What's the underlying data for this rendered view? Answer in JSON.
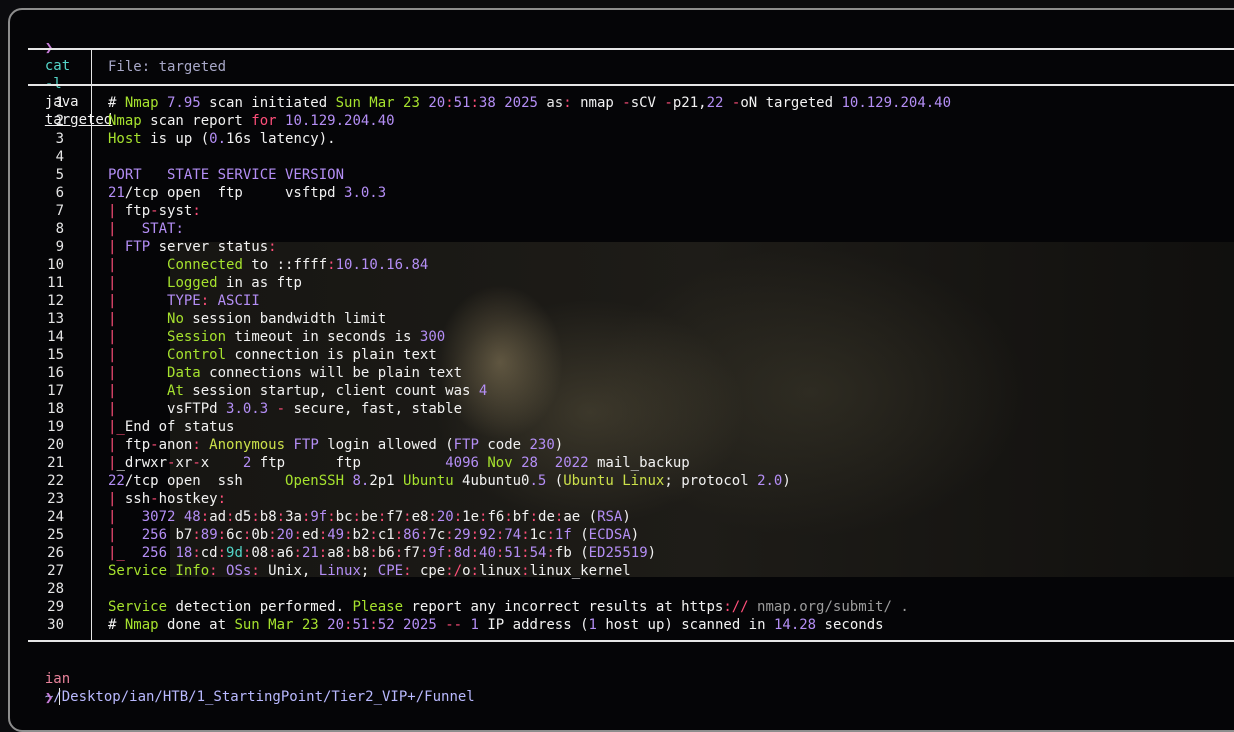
{
  "command": {
    "chevron": "❯",
    "cmd": "cat",
    "flag": "-l",
    "lang": "java",
    "file": "targeted"
  },
  "file_header": {
    "label": "File:",
    "name": "targeted"
  },
  "lines": [
    [
      [
        "# ",
        "w"
      ],
      [
        "Nmap",
        "g"
      ],
      [
        " 7.95",
        "p"
      ],
      [
        " scan initiated ",
        "w"
      ],
      [
        "Sun Mar 23",
        "g"
      ],
      [
        " 20",
        "p"
      ],
      [
        ":",
        "r"
      ],
      [
        "51",
        "p"
      ],
      [
        ":",
        "r"
      ],
      [
        "38",
        "p"
      ],
      [
        " 2025",
        "p"
      ],
      [
        " as",
        ""
      ],
      [
        ":",
        "r"
      ],
      [
        " nmap ",
        "w"
      ],
      [
        "-",
        "r"
      ],
      [
        "sCV ",
        "w"
      ],
      [
        "-",
        "r"
      ],
      [
        "p21",
        "w"
      ],
      [
        ",",
        "w"
      ],
      [
        "22",
        "p"
      ],
      [
        " ",
        "w"
      ],
      [
        "-",
        "r"
      ],
      [
        "oN targeted ",
        "w"
      ],
      [
        "10.129.204.40",
        "p"
      ]
    ],
    [
      [
        "Nmap",
        "g"
      ],
      [
        " scan report ",
        "w"
      ],
      [
        "for",
        "r"
      ],
      [
        " 10.129.204.40",
        "p"
      ]
    ],
    [
      [
        "Host",
        "g"
      ],
      [
        " is up (",
        "w"
      ],
      [
        "0.",
        "p"
      ],
      [
        "16s latency).",
        "w"
      ]
    ],
    [
      [
        "",
        ""
      ]
    ],
    [
      [
        "PORT   STATE SERVICE VERSION",
        "p"
      ]
    ],
    [
      [
        "21",
        "p"
      ],
      [
        "/tcp open  ftp     vsftpd ",
        "w"
      ],
      [
        "3.0.3",
        "p"
      ]
    ],
    [
      [
        "|",
        "r"
      ],
      [
        " ftp",
        "w"
      ],
      [
        "-",
        "r"
      ],
      [
        "syst",
        "w"
      ],
      [
        ":",
        "r"
      ]
    ],
    [
      [
        "|",
        "r"
      ],
      [
        "   STAT:",
        "p"
      ]
    ],
    [
      [
        "|",
        "r"
      ],
      [
        " FTP",
        "p"
      ],
      [
        " server status",
        "w"
      ],
      [
        ":",
        "r"
      ]
    ],
    [
      [
        "|",
        "r"
      ],
      [
        "      ",
        "w"
      ],
      [
        "Connected",
        "g"
      ],
      [
        " to ",
        "w"
      ],
      [
        "::",
        "w"
      ],
      [
        "ffff",
        "w"
      ],
      [
        ":",
        "r"
      ],
      [
        "10.10.16.84",
        "p"
      ]
    ],
    [
      [
        "|",
        "r"
      ],
      [
        "      ",
        "w"
      ],
      [
        "Logged",
        "g"
      ],
      [
        " in as ftp",
        "w"
      ]
    ],
    [
      [
        "|",
        "r"
      ],
      [
        "      ",
        "w"
      ],
      [
        "TYPE",
        "p"
      ],
      [
        ":",
        "r"
      ],
      [
        " ASCII",
        "p"
      ]
    ],
    [
      [
        "|",
        "r"
      ],
      [
        "      ",
        "w"
      ],
      [
        "No",
        "g"
      ],
      [
        " session bandwidth limit",
        "w"
      ]
    ],
    [
      [
        "|",
        "r"
      ],
      [
        "      ",
        "w"
      ],
      [
        "Session",
        "g"
      ],
      [
        " timeout in seconds is ",
        "w"
      ],
      [
        "300",
        "p"
      ]
    ],
    [
      [
        "|",
        "r"
      ],
      [
        "      ",
        "w"
      ],
      [
        "Control",
        "g"
      ],
      [
        " connection is plain text",
        "w"
      ]
    ],
    [
      [
        "|",
        "r"
      ],
      [
        "      ",
        "w"
      ],
      [
        "Data",
        "g"
      ],
      [
        " connections will be plain text",
        "w"
      ]
    ],
    [
      [
        "|",
        "r"
      ],
      [
        "      ",
        "w"
      ],
      [
        "At",
        "g"
      ],
      [
        " session startup, client count was ",
        "w"
      ],
      [
        "4",
        "p"
      ]
    ],
    [
      [
        "|",
        "r"
      ],
      [
        "      vsFTPd ",
        "w"
      ],
      [
        "3.0.3",
        "p"
      ],
      [
        " - ",
        "r"
      ],
      [
        "secure, fast, stable",
        "w"
      ]
    ],
    [
      [
        "|_",
        "r"
      ],
      [
        "End of status",
        "w"
      ]
    ],
    [
      [
        "|",
        "r"
      ],
      [
        " ftp",
        "w"
      ],
      [
        "-",
        "r"
      ],
      [
        "anon",
        "w"
      ],
      [
        ":",
        "r"
      ],
      [
        " Anonymous",
        "y"
      ],
      [
        " FTP",
        "p"
      ],
      [
        " login allowed (",
        "w"
      ],
      [
        "FTP",
        "p"
      ],
      [
        " code ",
        "w"
      ],
      [
        "230",
        "p"
      ],
      [
        ")",
        "w"
      ]
    ],
    [
      [
        "|",
        "r"
      ],
      [
        "_drwxr",
        "w"
      ],
      [
        "-",
        "r"
      ],
      [
        "xr",
        "w"
      ],
      [
        "-",
        "r"
      ],
      [
        "x    ",
        "w"
      ],
      [
        "2",
        "p"
      ],
      [
        " ftp      ftp          ",
        "w"
      ],
      [
        "4096",
        "p"
      ],
      [
        " Nov ",
        "g"
      ],
      [
        "28",
        "p"
      ],
      [
        "  2022",
        "p"
      ],
      [
        " mail_backup",
        "w"
      ]
    ],
    [
      [
        "22",
        "p"
      ],
      [
        "/tcp open  ssh     ",
        "w"
      ],
      [
        "OpenSSH",
        "g"
      ],
      [
        " 8.",
        "p"
      ],
      [
        "2p1 ",
        "w"
      ],
      [
        "Ubuntu",
        "g"
      ],
      [
        " 4ubuntu0",
        "w"
      ],
      [
        ".5",
        "p"
      ],
      [
        " (",
        "w"
      ],
      [
        "Ubuntu Linux",
        "y"
      ],
      [
        "; protocol ",
        "w"
      ],
      [
        "2.0",
        "p"
      ],
      [
        ")",
        "w"
      ]
    ],
    [
      [
        "|",
        "r"
      ],
      [
        " ssh",
        "w"
      ],
      [
        "-",
        "r"
      ],
      [
        "hostkey",
        "w"
      ],
      [
        ":",
        "r"
      ]
    ],
    [
      [
        "|",
        "r"
      ],
      [
        "   ",
        "w"
      ],
      [
        "3072",
        "p"
      ],
      [
        " 48",
        "p"
      ],
      [
        ":",
        "r"
      ],
      [
        "ad",
        "w"
      ],
      [
        ":",
        "r"
      ],
      [
        "d5",
        "w"
      ],
      [
        ":",
        "r"
      ],
      [
        "b8",
        "w"
      ],
      [
        ":",
        "r"
      ],
      [
        "3a",
        "w"
      ],
      [
        ":",
        "r"
      ],
      [
        "9f",
        "p"
      ],
      [
        ":",
        "r"
      ],
      [
        "bc",
        "w"
      ],
      [
        ":",
        "r"
      ],
      [
        "be",
        "w"
      ],
      [
        ":",
        "r"
      ],
      [
        "f7",
        "w"
      ],
      [
        ":",
        "r"
      ],
      [
        "e8",
        "w"
      ],
      [
        ":",
        "r"
      ],
      [
        "20",
        "p"
      ],
      [
        ":",
        "r"
      ],
      [
        "1e",
        "w"
      ],
      [
        ":",
        "r"
      ],
      [
        "f6",
        "w"
      ],
      [
        ":",
        "r"
      ],
      [
        "bf",
        "w"
      ],
      [
        ":",
        "r"
      ],
      [
        "de",
        "w"
      ],
      [
        ":",
        "r"
      ],
      [
        "ae",
        "w"
      ],
      [
        " (",
        "w"
      ],
      [
        "RSA",
        "p"
      ],
      [
        ")",
        "w"
      ]
    ],
    [
      [
        "|",
        "r"
      ],
      [
        "   ",
        "w"
      ],
      [
        "256",
        "p"
      ],
      [
        " b7",
        "w"
      ],
      [
        ":",
        "r"
      ],
      [
        "89",
        "p"
      ],
      [
        ":",
        "r"
      ],
      [
        "6c",
        "w"
      ],
      [
        ":",
        "r"
      ],
      [
        "0b",
        "w"
      ],
      [
        ":",
        "r"
      ],
      [
        "20",
        "p"
      ],
      [
        ":",
        "r"
      ],
      [
        "ed",
        "w"
      ],
      [
        ":",
        "r"
      ],
      [
        "49",
        "p"
      ],
      [
        ":",
        "r"
      ],
      [
        "b2",
        "w"
      ],
      [
        ":",
        "r"
      ],
      [
        "c1",
        "w"
      ],
      [
        ":",
        "r"
      ],
      [
        "86",
        "p"
      ],
      [
        ":",
        "r"
      ],
      [
        "7c",
        "w"
      ],
      [
        ":",
        "r"
      ],
      [
        "29",
        "p"
      ],
      [
        ":",
        "r"
      ],
      [
        "92",
        "p"
      ],
      [
        ":",
        "r"
      ],
      [
        "74",
        "p"
      ],
      [
        ":",
        "r"
      ],
      [
        "1c",
        "w"
      ],
      [
        ":",
        "r"
      ],
      [
        "1f",
        "p"
      ],
      [
        " (",
        "w"
      ],
      [
        "ECDSA",
        "p"
      ],
      [
        ")",
        "w"
      ]
    ],
    [
      [
        "|_",
        "r"
      ],
      [
        "  ",
        "w"
      ],
      [
        "256",
        "p"
      ],
      [
        " 18",
        "p"
      ],
      [
        ":",
        "r"
      ],
      [
        "cd",
        "w"
      ],
      [
        ":",
        "r"
      ],
      [
        "9d",
        "c"
      ],
      [
        ":",
        "r"
      ],
      [
        "08",
        "w"
      ],
      [
        ":",
        "r"
      ],
      [
        "a6",
        "w"
      ],
      [
        ":",
        "r"
      ],
      [
        "21",
        "p"
      ],
      [
        ":",
        "r"
      ],
      [
        "a8",
        "w"
      ],
      [
        ":",
        "r"
      ],
      [
        "b8",
        "w"
      ],
      [
        ":",
        "r"
      ],
      [
        "b6",
        "w"
      ],
      [
        ":",
        "r"
      ],
      [
        "f7",
        "w"
      ],
      [
        ":",
        "r"
      ],
      [
        "9f",
        "p"
      ],
      [
        ":",
        "r"
      ],
      [
        "8d",
        "p"
      ],
      [
        ":",
        "r"
      ],
      [
        "40",
        "p"
      ],
      [
        ":",
        "r"
      ],
      [
        "51",
        "p"
      ],
      [
        ":",
        "r"
      ],
      [
        "54",
        "p"
      ],
      [
        ":",
        "r"
      ],
      [
        "fb",
        "w"
      ],
      [
        " (",
        "w"
      ],
      [
        "ED25519",
        "p"
      ],
      [
        ")",
        "w"
      ]
    ],
    [
      [
        "Service Info",
        "g"
      ],
      [
        ":",
        "r"
      ],
      [
        " OSs",
        "p"
      ],
      [
        ":",
        "r"
      ],
      [
        " Unix",
        "w"
      ],
      [
        ", ",
        "w"
      ],
      [
        "Linux",
        "p"
      ],
      [
        ";",
        "w"
      ],
      [
        " CPE",
        "p"
      ],
      [
        ":",
        "r"
      ],
      [
        " cpe",
        "w"
      ],
      [
        ":/",
        "r"
      ],
      [
        "o",
        "w"
      ],
      [
        ":",
        "r"
      ],
      [
        "linux",
        "w"
      ],
      [
        ":",
        "r"
      ],
      [
        "linux_kernel",
        "w"
      ]
    ],
    [
      [
        "",
        ""
      ]
    ],
    [
      [
        "Service",
        "g"
      ],
      [
        " detection performed. ",
        "w"
      ],
      [
        "Please",
        "g"
      ],
      [
        " report any incorrect results at https",
        "w"
      ],
      [
        "://",
        "r"
      ],
      [
        " nmap.org/submit/ .",
        "gy"
      ]
    ],
    [
      [
        "# ",
        "w"
      ],
      [
        "Nmap",
        "g"
      ],
      [
        " done at ",
        "w"
      ],
      [
        "Sun Mar 23",
        "g"
      ],
      [
        " 20",
        "p"
      ],
      [
        ":",
        "r"
      ],
      [
        "51",
        "p"
      ],
      [
        ":",
        "r"
      ],
      [
        "52",
        "p"
      ],
      [
        " 2025",
        "p"
      ],
      [
        " --",
        "r"
      ],
      [
        " 1",
        "p"
      ],
      [
        " IP address (",
        "w"
      ],
      [
        "1",
        "p"
      ],
      [
        " host up) scanned in ",
        "w"
      ],
      [
        "14.28",
        "p"
      ],
      [
        " seconds",
        "w"
      ]
    ]
  ],
  "prompt": {
    "user": "ian",
    "path": "~/Desktop/ian/HTB/1_StartingPoint/Tier2_VIP+/Funnel",
    "chevron": "❯"
  }
}
